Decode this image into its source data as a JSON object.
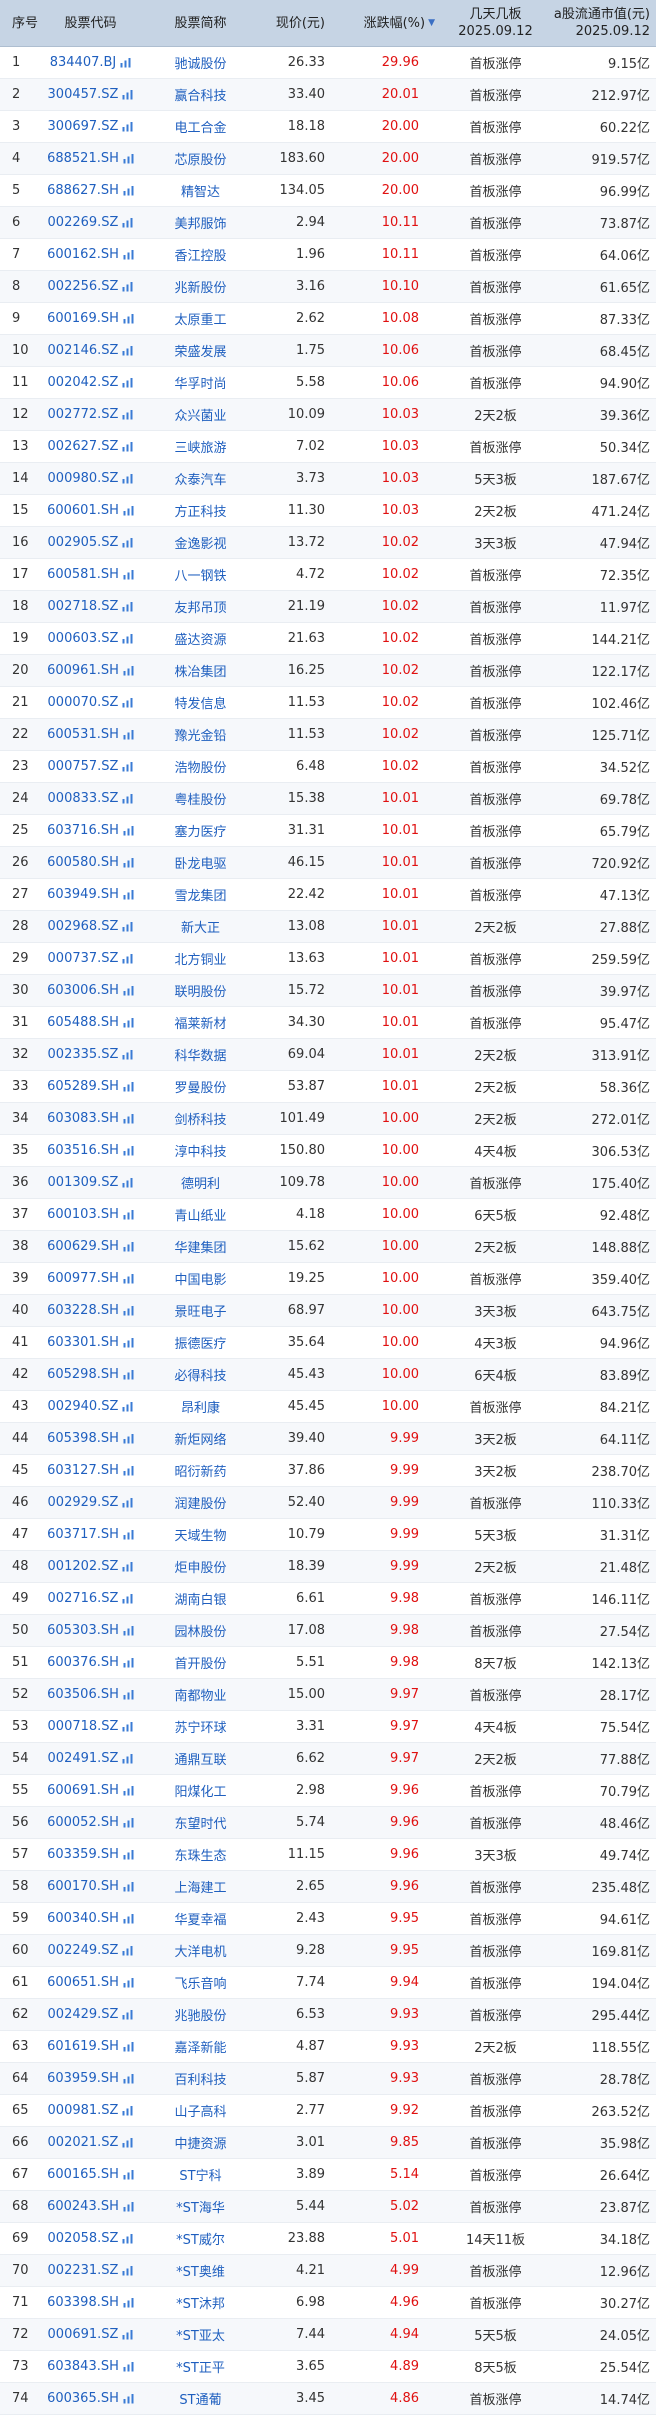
{
  "header": {
    "idx": "序号",
    "code": "股票代码",
    "name": "股票简称",
    "price": "现价(元)",
    "change": "涨跌幅(%)",
    "days_line1": "几天几板",
    "days_line2": "2025.09.12",
    "mcap_line1": "a股流通市值(元)",
    "mcap_line2": "2025.09.12"
  },
  "colors": {
    "up": "#e01010",
    "link": "#1f5fbf",
    "header_bg": "#c6d4e4"
  },
  "rows": [
    [
      "1",
      "834407.BJ",
      "驰诚股份",
      "26.33",
      "29.96",
      "首板涨停",
      "9.15亿"
    ],
    [
      "2",
      "300457.SZ",
      "赢合科技",
      "33.40",
      "20.01",
      "首板涨停",
      "212.97亿"
    ],
    [
      "3",
      "300697.SZ",
      "电工合金",
      "18.18",
      "20.00",
      "首板涨停",
      "60.22亿"
    ],
    [
      "4",
      "688521.SH",
      "芯原股份",
      "183.60",
      "20.00",
      "首板涨停",
      "919.57亿"
    ],
    [
      "5",
      "688627.SH",
      "精智达",
      "134.05",
      "20.00",
      "首板涨停",
      "96.99亿"
    ],
    [
      "6",
      "002269.SZ",
      "美邦服饰",
      "2.94",
      "10.11",
      "首板涨停",
      "73.87亿"
    ],
    [
      "7",
      "600162.SH",
      "香江控股",
      "1.96",
      "10.11",
      "首板涨停",
      "64.06亿"
    ],
    [
      "8",
      "002256.SZ",
      "兆新股份",
      "3.16",
      "10.10",
      "首板涨停",
      "61.65亿"
    ],
    [
      "9",
      "600169.SH",
      "太原重工",
      "2.62",
      "10.08",
      "首板涨停",
      "87.33亿"
    ],
    [
      "10",
      "002146.SZ",
      "荣盛发展",
      "1.75",
      "10.06",
      "首板涨停",
      "68.45亿"
    ],
    [
      "11",
      "002042.SZ",
      "华孚时尚",
      "5.58",
      "10.06",
      "首板涨停",
      "94.90亿"
    ],
    [
      "12",
      "002772.SZ",
      "众兴菌业",
      "10.09",
      "10.03",
      "2天2板",
      "39.36亿"
    ],
    [
      "13",
      "002627.SZ",
      "三峡旅游",
      "7.02",
      "10.03",
      "首板涨停",
      "50.34亿"
    ],
    [
      "14",
      "000980.SZ",
      "众泰汽车",
      "3.73",
      "10.03",
      "5天3板",
      "187.67亿"
    ],
    [
      "15",
      "600601.SH",
      "方正科技",
      "11.30",
      "10.03",
      "2天2板",
      "471.24亿"
    ],
    [
      "16",
      "002905.SZ",
      "金逸影视",
      "13.72",
      "10.02",
      "3天3板",
      "47.94亿"
    ],
    [
      "17",
      "600581.SH",
      "八一钢铁",
      "4.72",
      "10.02",
      "首板涨停",
      "72.35亿"
    ],
    [
      "18",
      "002718.SZ",
      "友邦吊顶",
      "21.19",
      "10.02",
      "首板涨停",
      "11.97亿"
    ],
    [
      "19",
      "000603.SZ",
      "盛达资源",
      "21.63",
      "10.02",
      "首板涨停",
      "144.21亿"
    ],
    [
      "20",
      "600961.SH",
      "株冶集团",
      "16.25",
      "10.02",
      "首板涨停",
      "122.17亿"
    ],
    [
      "21",
      "000070.SZ",
      "特发信息",
      "11.53",
      "10.02",
      "首板涨停",
      "102.46亿"
    ],
    [
      "22",
      "600531.SH",
      "豫光金铅",
      "11.53",
      "10.02",
      "首板涨停",
      "125.71亿"
    ],
    [
      "23",
      "000757.SZ",
      "浩物股份",
      "6.48",
      "10.02",
      "首板涨停",
      "34.52亿"
    ],
    [
      "24",
      "000833.SZ",
      "粤桂股份",
      "15.38",
      "10.01",
      "首板涨停",
      "69.78亿"
    ],
    [
      "25",
      "603716.SH",
      "塞力医疗",
      "31.31",
      "10.01",
      "首板涨停",
      "65.79亿"
    ],
    [
      "26",
      "600580.SH",
      "卧龙电驱",
      "46.15",
      "10.01",
      "首板涨停",
      "720.92亿"
    ],
    [
      "27",
      "603949.SH",
      "雪龙集团",
      "22.42",
      "10.01",
      "首板涨停",
      "47.13亿"
    ],
    [
      "28",
      "002968.SZ",
      "新大正",
      "13.08",
      "10.01",
      "2天2板",
      "27.88亿"
    ],
    [
      "29",
      "000737.SZ",
      "北方铜业",
      "13.63",
      "10.01",
      "首板涨停",
      "259.59亿"
    ],
    [
      "30",
      "603006.SH",
      "联明股份",
      "15.72",
      "10.01",
      "首板涨停",
      "39.97亿"
    ],
    [
      "31",
      "605488.SH",
      "福莱新材",
      "34.30",
      "10.01",
      "首板涨停",
      "95.47亿"
    ],
    [
      "32",
      "002335.SZ",
      "科华数据",
      "69.04",
      "10.01",
      "2天2板",
      "313.91亿"
    ],
    [
      "33",
      "605289.SH",
      "罗曼股份",
      "53.87",
      "10.01",
      "2天2板",
      "58.36亿"
    ],
    [
      "34",
      "603083.SH",
      "剑桥科技",
      "101.49",
      "10.00",
      "2天2板",
      "272.01亿"
    ],
    [
      "35",
      "603516.SH",
      "淳中科技",
      "150.80",
      "10.00",
      "4天4板",
      "306.53亿"
    ],
    [
      "36",
      "001309.SZ",
      "德明利",
      "109.78",
      "10.00",
      "首板涨停",
      "175.40亿"
    ],
    [
      "37",
      "600103.SH",
      "青山纸业",
      "4.18",
      "10.00",
      "6天5板",
      "92.48亿"
    ],
    [
      "38",
      "600629.SH",
      "华建集团",
      "15.62",
      "10.00",
      "2天2板",
      "148.88亿"
    ],
    [
      "39",
      "600977.SH",
      "中国电影",
      "19.25",
      "10.00",
      "首板涨停",
      "359.40亿"
    ],
    [
      "40",
      "603228.SH",
      "景旺电子",
      "68.97",
      "10.00",
      "3天3板",
      "643.75亿"
    ],
    [
      "41",
      "603301.SH",
      "振德医疗",
      "35.64",
      "10.00",
      "4天3板",
      "94.96亿"
    ],
    [
      "42",
      "605298.SH",
      "必得科技",
      "45.43",
      "10.00",
      "6天4板",
      "83.89亿"
    ],
    [
      "43",
      "002940.SZ",
      "昂利康",
      "45.45",
      "10.00",
      "首板涨停",
      "84.21亿"
    ],
    [
      "44",
      "605398.SH",
      "新炬网络",
      "39.40",
      "9.99",
      "3天2板",
      "64.11亿"
    ],
    [
      "45",
      "603127.SH",
      "昭衍新药",
      "37.86",
      "9.99",
      "3天2板",
      "238.70亿"
    ],
    [
      "46",
      "002929.SZ",
      "润建股份",
      "52.40",
      "9.99",
      "首板涨停",
      "110.33亿"
    ],
    [
      "47",
      "603717.SH",
      "天域生物",
      "10.79",
      "9.99",
      "5天3板",
      "31.31亿"
    ],
    [
      "48",
      "001202.SZ",
      "炬申股份",
      "18.39",
      "9.99",
      "2天2板",
      "21.48亿"
    ],
    [
      "49",
      "002716.SZ",
      "湖南白银",
      "6.61",
      "9.98",
      "首板涨停",
      "146.11亿"
    ],
    [
      "50",
      "605303.SH",
      "园林股份",
      "17.08",
      "9.98",
      "首板涨停",
      "27.54亿"
    ],
    [
      "51",
      "600376.SH",
      "首开股份",
      "5.51",
      "9.98",
      "8天7板",
      "142.13亿"
    ],
    [
      "52",
      "603506.SH",
      "南都物业",
      "15.00",
      "9.97",
      "首板涨停",
      "28.17亿"
    ],
    [
      "53",
      "000718.SZ",
      "苏宁环球",
      "3.31",
      "9.97",
      "4天4板",
      "75.54亿"
    ],
    [
      "54",
      "002491.SZ",
      "通鼎互联",
      "6.62",
      "9.97",
      "2天2板",
      "77.88亿"
    ],
    [
      "55",
      "600691.SH",
      "阳煤化工",
      "2.98",
      "9.96",
      "首板涨停",
      "70.79亿"
    ],
    [
      "56",
      "600052.SH",
      "东望时代",
      "5.74",
      "9.96",
      "首板涨停",
      "48.46亿"
    ],
    [
      "57",
      "603359.SH",
      "东珠生态",
      "11.15",
      "9.96",
      "3天3板",
      "49.74亿"
    ],
    [
      "58",
      "600170.SH",
      "上海建工",
      "2.65",
      "9.96",
      "首板涨停",
      "235.48亿"
    ],
    [
      "59",
      "600340.SH",
      "华夏幸福",
      "2.43",
      "9.95",
      "首板涨停",
      "94.61亿"
    ],
    [
      "60",
      "002249.SZ",
      "大洋电机",
      "9.28",
      "9.95",
      "首板涨停",
      "169.81亿"
    ],
    [
      "61",
      "600651.SH",
      "飞乐音响",
      "7.74",
      "9.94",
      "首板涨停",
      "194.04亿"
    ],
    [
      "62",
      "002429.SZ",
      "兆驰股份",
      "6.53",
      "9.93",
      "首板涨停",
      "295.44亿"
    ],
    [
      "63",
      "601619.SH",
      "嘉泽新能",
      "4.87",
      "9.93",
      "2天2板",
      "118.55亿"
    ],
    [
      "64",
      "603959.SH",
      "百利科技",
      "5.87",
      "9.93",
      "首板涨停",
      "28.78亿"
    ],
    [
      "65",
      "000981.SZ",
      "山子高科",
      "2.77",
      "9.92",
      "首板涨停",
      "263.52亿"
    ],
    [
      "66",
      "002021.SZ",
      "中捷资源",
      "3.01",
      "9.85",
      "首板涨停",
      "35.98亿"
    ],
    [
      "67",
      "600165.SH",
      "ST宁科",
      "3.89",
      "5.14",
      "首板涨停",
      "26.64亿"
    ],
    [
      "68",
      "600243.SH",
      "*ST海华",
      "5.44",
      "5.02",
      "首板涨停",
      "23.87亿"
    ],
    [
      "69",
      "002058.SZ",
      "*ST威尔",
      "23.88",
      "5.01",
      "14天11板",
      "34.18亿"
    ],
    [
      "70",
      "002231.SZ",
      "*ST奥维",
      "4.21",
      "4.99",
      "首板涨停",
      "12.96亿"
    ],
    [
      "71",
      "603398.SH",
      "*ST沐邦",
      "6.98",
      "4.96",
      "首板涨停",
      "30.27亿"
    ],
    [
      "72",
      "000691.SZ",
      "*ST亚太",
      "7.44",
      "4.94",
      "5天5板",
      "24.05亿"
    ],
    [
      "73",
      "603843.SH",
      "*ST正平",
      "3.65",
      "4.89",
      "8天5板",
      "25.54亿"
    ],
    [
      "74",
      "600365.SH",
      "ST通葡",
      "3.45",
      "4.86",
      "首板涨停",
      "14.74亿"
    ]
  ]
}
